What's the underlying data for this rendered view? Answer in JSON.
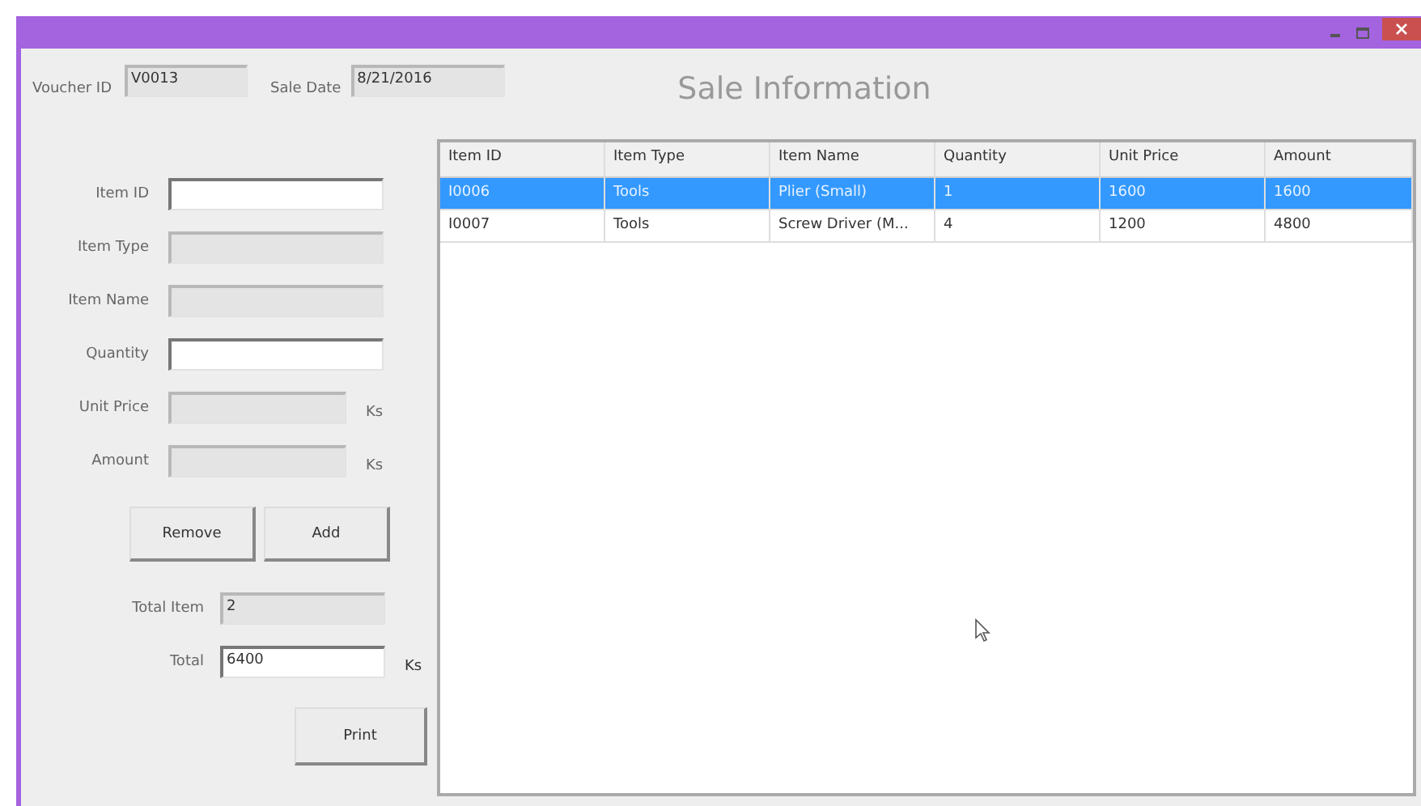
{
  "header": {
    "voucher": {
      "label": "Voucher ID",
      "value": "V0013"
    },
    "sale_date": {
      "label": "Sale Date",
      "value": "8/21/2016"
    },
    "title": "Sale Information"
  },
  "form": {
    "fields": [
      {
        "label": "Item ID",
        "disabled": false
      },
      {
        "label": "Item Type",
        "disabled": true
      },
      {
        "label": "Item Name",
        "disabled": true
      },
      {
        "label": "Quantity",
        "disabled": false
      },
      {
        "label": "Unit Price",
        "disabled": true,
        "unit": "Ks"
      },
      {
        "label": "Amount",
        "disabled": true,
        "unit": "Ks"
      }
    ],
    "buttons": [
      "Remove",
      "Add"
    ],
    "total_item": {
      "label": "Total Item",
      "value": "2",
      "disabled": true
    },
    "total": {
      "label": "Total",
      "value": "6400",
      "disabled": false,
      "unit": "Ks"
    },
    "print_button": "Print"
  },
  "table": {
    "columns": [
      "Item ID",
      "Item Type",
      "Item Name",
      "Quantity",
      "Unit Price",
      "Amount"
    ],
    "rows": [
      {
        "cells": [
          "I0006",
          "Tools",
          "Plier (Small)",
          "1",
          "1600",
          "1600"
        ],
        "selected": true
      },
      {
        "cells": [
          "I0007",
          "Tools",
          "Screw Driver (M...",
          "4",
          "1200",
          "4800"
        ],
        "selected": false
      }
    ]
  }
}
